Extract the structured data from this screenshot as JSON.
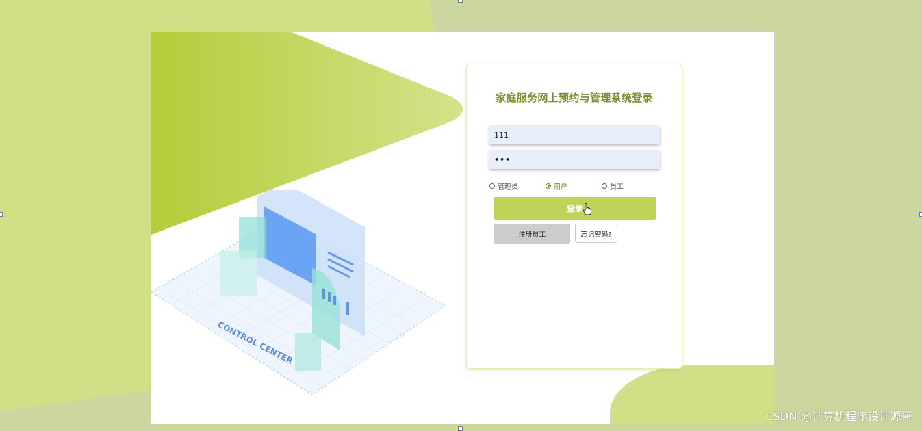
{
  "login": {
    "title": "家庭服务网上预约与管理系统登录",
    "username_value": "111",
    "password_value": "•••",
    "roles": [
      {
        "label": "管理员",
        "checked": false
      },
      {
        "label": "用户",
        "checked": true
      },
      {
        "label": "员工",
        "checked": false
      }
    ],
    "login_label": "登录",
    "register_label": "注册员工",
    "forgot_label": "忘记密码?"
  },
  "illustration": {
    "caption": "CONTROL CENTER"
  },
  "watermark": "CSDN @计算机程序设计源哥",
  "colors": {
    "accent": "#bdd458",
    "title": "#7a8f2c",
    "background": "#cbd79f",
    "input_bg": "#e8eefb"
  }
}
